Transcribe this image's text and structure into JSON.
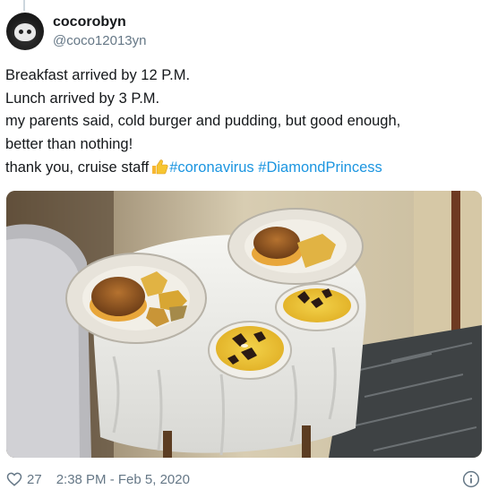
{
  "tweet": {
    "display_name": "cocorobyn",
    "handle": "@coco12013yn",
    "lines": [
      "Breakfast arrived by 12 P.M.",
      "Lunch arrived by 3 P.M.",
      "my parents said, cold burger and pudding, but good enough,",
      "better than nothing!"
    ],
    "last_line_text": "thank you, cruise staff",
    "last_line_emoji": "thumbs-up-emoji",
    "hashtags": [
      "#coronavirus",
      "#DiamondPrincess"
    ],
    "likes": "27",
    "timestamp": "2:38 PM - Feb 5, 2020"
  },
  "colors": {
    "link": "#1b95e0",
    "meta_gray": "#657786",
    "text": "#14171a"
  },
  "icons": {
    "like": "heart-outline-icon",
    "info": "info-circle-icon"
  }
}
